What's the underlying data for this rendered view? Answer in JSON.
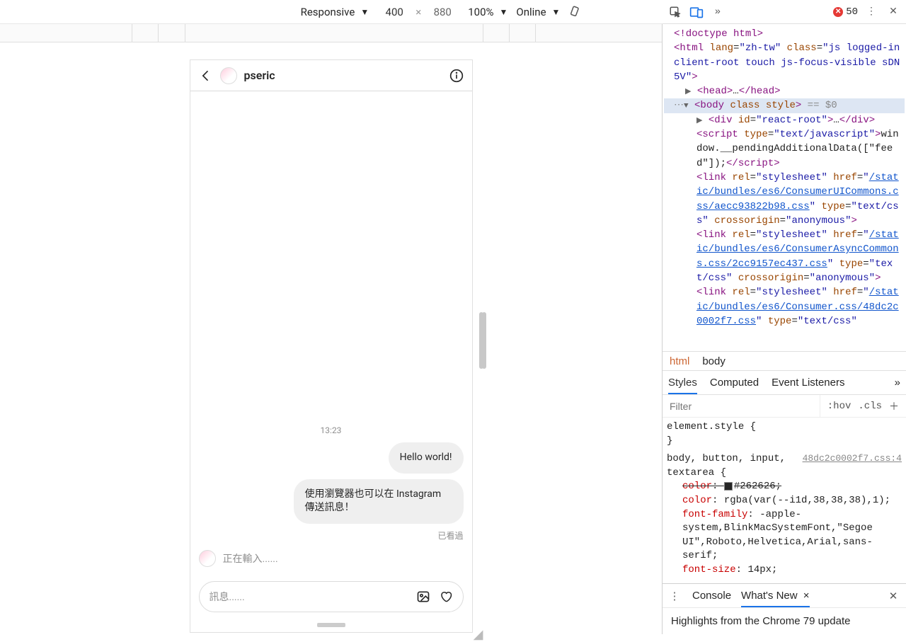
{
  "toolbar": {
    "device_mode": "Responsive",
    "width": "400",
    "height": "880",
    "zoom": "100%",
    "throttle": "Online",
    "error_count": "50"
  },
  "chat": {
    "username": "pseric",
    "timestamp": "13:23",
    "msg1": "Hello world!",
    "msg2": "使用瀏覽器也可以在 Instagram 傳送訊息！",
    "seen": "已看過",
    "typing": "正在輸入......",
    "composer_placeholder": "訊息......"
  },
  "dom": {
    "doctype": "<!doctype html>",
    "html_open_a": "html",
    "html_lang": "zh-tw",
    "html_class": "js logged-in client-root touch js-focus-visible sDN5V",
    "head": "head",
    "head_ell": "…",
    "body": "body",
    "body_attrs": "class style",
    "body_eq": "== $0",
    "react_div": "div",
    "react_id": "react-root",
    "script_tag": "script",
    "script_type": "text/javascript",
    "script_body": "window.__pendingAdditionalData([\"feed\"]);",
    "link_tag": "link",
    "rel": "stylesheet",
    "href1": "/static/bundles/es6/ConsumerUICommons.css/aecc93822b98.css",
    "type_css": "text/css",
    "crossorigin": "anonymous",
    "href2": "/static/bundles/es6/ConsumerAsyncCommons.css/2cc9157ec437.css",
    "href3": "/static/bundles/es6/Consumer.css/48dc2c0002f7.css"
  },
  "crumbs": {
    "a": "html",
    "b": "body"
  },
  "styleTabs": {
    "a": "Styles",
    "b": "Computed",
    "c": "Event Listeners"
  },
  "filter": {
    "placeholder": "Filter",
    "hov": ":hov",
    "cls": ".cls"
  },
  "css": {
    "elstyle": "element.style {",
    "elstyle_close": "}",
    "selector": "body, button, input, textarea {",
    "src": "48dc2c0002f7.css:4",
    "p1k": "color",
    "p1v": "#262626;",
    "p2k": "color",
    "p2v": "rgba(var(--i1d,38,38,38),1);",
    "p3k": "font-family",
    "p3v": "-apple-system,BlinkMacSystemFont,\"Segoe UI\",Roboto,Helvetica,Arial,sans-serif;",
    "p4k": "font-size",
    "p4v": "14px;"
  },
  "drawer": {
    "console": "Console",
    "whatsnew": "What's New",
    "highlight": "Highlights from the Chrome 79 update"
  }
}
